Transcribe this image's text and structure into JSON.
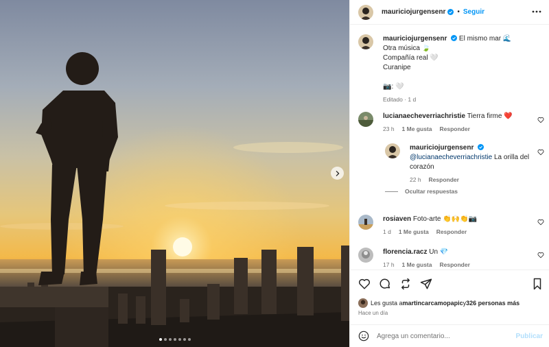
{
  "post": {
    "author": "mauriciojurgensenr",
    "follow_label": "Seguir",
    "header_separator": "•",
    "caption_first_line": "El mismo mar 🌊",
    "caption_lines": [
      "Otra música 🍃",
      "Compañía real 🤍",
      "Curanipe"
    ],
    "caption_credit": "📷: 🤍",
    "caption_meta": "Editado · 1 d"
  },
  "photo": {
    "carousel_count": 7,
    "carousel_active": 1
  },
  "comments": [
    {
      "user": "lucianaecheverriachristie",
      "text": "Tierra firme ❤️",
      "time": "23 h",
      "likes": "1 Me gusta",
      "reply_label": "Responder"
    },
    {
      "user": "mauriciojurgensenr",
      "mention": "@lucianaecheverriachristie",
      "text": " La orilla del corazón",
      "time": "22 h",
      "reply_label": "Responder"
    },
    {
      "user": "rosiaven",
      "text": "Foto-arte 👏🙌👏📷",
      "time": "1 d",
      "likes": "1 Me gusta",
      "reply_label": "Responder"
    },
    {
      "user": "florencia.racz",
      "text": "Un 💎",
      "time": "17 h",
      "likes": "1 Me gusta",
      "reply_label": "Responder"
    }
  ],
  "hide_replies_label": "Ocultar respuestas",
  "likes": {
    "prefix": "Les gusta a ",
    "user": "martincarcamopapic",
    "joiner": " y ",
    "others": "326 personas más"
  },
  "posted_time": "Hace un día",
  "add_comment": {
    "placeholder": "Agrega un comentario...",
    "publish_label": "Publicar"
  },
  "colors": {
    "accent": "#0095f6",
    "verified": "#0095f6",
    "heart_red": "#ed4956",
    "publish_disabled": "#b2dffc"
  }
}
